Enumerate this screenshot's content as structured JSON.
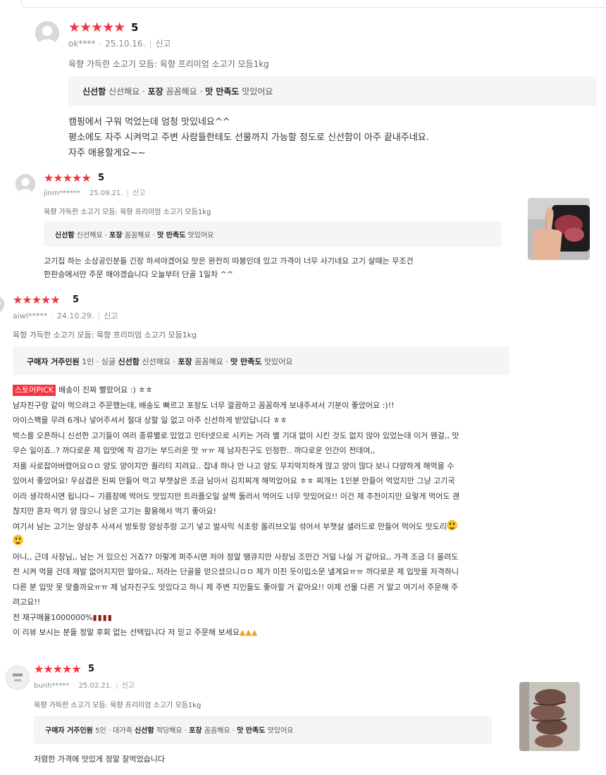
{
  "reviews": [
    {
      "stars": "★★★★★",
      "rating": "5",
      "user": "ok****",
      "date": "25.10.16.",
      "report": "신고",
      "product": "육향 가득한 소고기 모듬: 육향 프리미엄 소고기 모듬1kg",
      "options": [
        {
          "key": "신선함",
          "val": "신선해요"
        },
        {
          "key": "포장",
          "val": "꼼꼼해요"
        },
        {
          "key": "맛 만족도",
          "val": "맛있어요"
        }
      ],
      "body": [
        "캠핑에서 구워 먹었는데 엄청 맛있네요^^",
        "평소에도 자주 시켜먹고 주변 사람들한테도 선물까지 가능할 정도로 신선함이 아주 끝내주네요.",
        "자주 애용할게요~~"
      ]
    },
    {
      "stars": "★★★★★",
      "rating": "5",
      "user": "jinm******",
      "date": "25.09.21.",
      "report": "신고",
      "product": "육향 가득한 소고기 모듬: 육향 프리미엄 소고기 모듬1kg",
      "options": [
        {
          "key": "신선함",
          "val": "신선해요"
        },
        {
          "key": "포장",
          "val": "꼼꼼해요"
        },
        {
          "key": "맛 만족도",
          "val": "맛있어요"
        }
      ],
      "body": [
        "고기집 하는 소상공인분들 긴장 하셔야겠어요 맛은 완전히 따봉인데 있고 가격이 너무 사기네요 고기 살때는 무조건",
        "한판승에서만 주문 해야겠습니다 오늘부터 단골 1일차 ^^"
      ]
    },
    {
      "stars": "★★★★★",
      "rating": "5",
      "user": "aiwl*****",
      "date": "24.10.29.",
      "report": "신고",
      "product": "육향 가득한 소고기 모듬: 육향 프리미엄 소고기 모듬1kg",
      "options": [
        {
          "key": "구매자 거주인원",
          "val": "1인 · 싱글"
        },
        {
          "key": "신선함",
          "val": "신선해요"
        },
        {
          "key": "포장",
          "val": "꼼꼼해요"
        },
        {
          "key": "맛 만족도",
          "val": "맛있어요"
        }
      ],
      "badge": "스토어PICK",
      "headline": "배송이 진짜 빨랐어요 :) ㅎㅎ",
      "body": [
        "남자친구랑 같이 먹으려고 주문했는데, 배송도 빠르고 포장도 너무 깔끔하고 꼼꼼하게 보내주셔서 기분이 좋았어요 :)!!",
        "아이스팩을 무려 6개나 넣어주셔서 절대 상할 일 없고 아주 신선하게 받았답니다 ㅎㅎ",
        "박스를 오픈하니 신선한 고기들이 여러 종류별로 있었고 인터넷으로 시키는 거라 별 기대 없이 시킨 것도 없지 않아 있었는데 이거 웬걸,, 맛",
        "무슨 일이죠..? 까다로운 제 입맛에 착 감기는 부드러운 맛 ㅠㅠ 제 남자친구도 인정한.. 까다로운 인간이 전데여,,",
        "저를 사로잡아버렸어요ㅁㅁ 양도 양이지만 퀄리티 지려요.. 잡내 하나 안 나고 양도 무지막지하게 많고 양이 많다 보니 다양하게 해먹을 수",
        "있어서 좋았어요! 우삼겹은 된찌 만들어 먹고 부챗살은 조금 남아서 김치찌개 해먹었어요 ㅎㅎ 찌개는 1인분 만들어 먹었지만 그냥 고기국",
        "이라 생각하시면 됩니다~ 기름장에 먹어도 맛있지만 트러플오일 살짝 둘러서 먹어도 너무 맛있어요!! 이건 제 추천이지만 요렇게 먹어도 괜",
        "찮지만 혼자 먹기 양 많으니 남은 고기는 활용해서 먹기 좋아요!",
        "여기서 남는 고기는 양상추 사셔서 방토랑 양상추랑 고기 넣고 발사믹 식초랑 올리브오일 섞어서 부챗살 샐러드로 만들어 먹어도 맛도리",
        "",
        "아니,, 근데 사장님,, 남는 거 있으신 거죠?? 이렇게 퍼주시면 저야 정말 땡큐지만 사장님 조만간 거덜 나실 거 같아요,, 가격 조금 더 올려도",
        "전 시켜 먹을 건데 제발 없어지지만 말아요,, 저라는 단골을 얻으셨으니ㅁㅁ 제가 미친 듯이입소문 낼게요ㅠㅠ 까다로운 제 입맛을 저격하니",
        "다른 분 입맛 못 맞출까요ㅠㅠ 제 남자친구도 맛있다고 하니 제 주변 지인들도 좋아할 거 같아요!! 이제 선물 다른 거 말고 여기서 주문해 주",
        "려고요!!",
        "전 재구매율1000000%",
        "이 리뷰 보시는 분들 정말 후회 없는 선택입니다 저 믿고 주문해 보세요"
      ]
    },
    {
      "stars": "★★★★★",
      "rating": "5",
      "user": "bunh*****",
      "date": "25.02.21.",
      "report": "신고",
      "product": "육향 가득한 소고기 모듬: 육향 프리미엄 소고기 모듬1kg",
      "options": [
        {
          "key": "구매자 거주인원",
          "val": "5인 · 대가족"
        },
        {
          "key": "신선함",
          "val": "적당해요"
        },
        {
          "key": "포장",
          "val": "꼼꼼해요"
        },
        {
          "key": "맛 만족도",
          "val": "맛있어요"
        }
      ],
      "body": [
        "저렴한 가격에 맛있게 정말 잘먹었습니다"
      ]
    }
  ],
  "icons": {
    "avatar": "person-silhouette",
    "smile": "grinning-face-emoji",
    "fire": "fire-emoji",
    "pray": "folded-hands-emoji"
  },
  "colors": {
    "star": "#f6343f",
    "badge": "#f6343f",
    "option_bg": "#f5f5f5"
  }
}
